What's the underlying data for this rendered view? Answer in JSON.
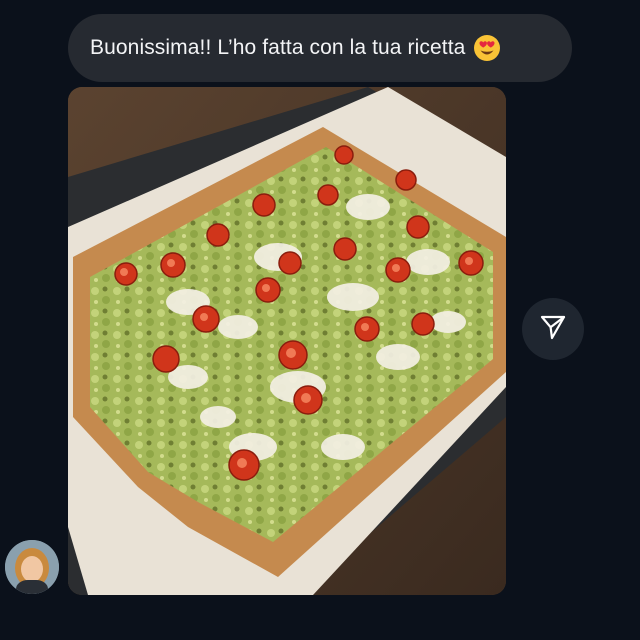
{
  "message": {
    "text": "Buonissima!! L’ho fatta con la tua ricetta",
    "emoji": "heart-eyes-emoji"
  },
  "photo": {
    "subject": "pizza-image"
  },
  "actions": {
    "share_icon": "send-icon"
  },
  "sender": {
    "avatar": "avatar-photo"
  },
  "colors": {
    "background": "#0b111b",
    "bubble": "#262a31",
    "text": "#f3f4f6",
    "share_button": "#1f2630"
  }
}
